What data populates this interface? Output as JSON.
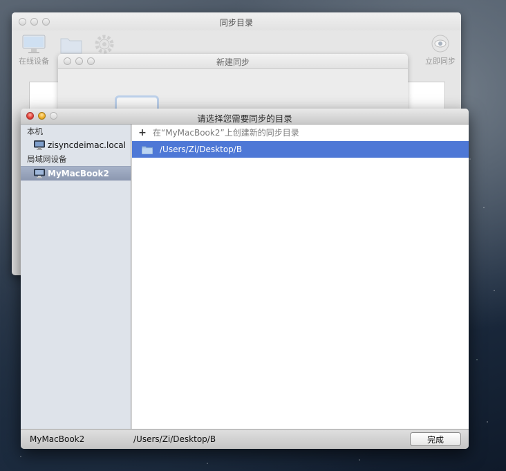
{
  "background_window": {
    "title": "同步目录",
    "toolbar": {
      "online_devices_label": "在线设备",
      "sync_now_label": "立即同步"
    }
  },
  "middle_sheet": {
    "title": "新建同步"
  },
  "dialog": {
    "title": "请选择您需要同步的目录",
    "sidebar": {
      "local_group_label": "本机",
      "local_items": [
        {
          "label": "zisyncdeimac.local",
          "icon": "imac-icon"
        }
      ],
      "lan_group_label": "局域网设备",
      "lan_items": [
        {
          "label": "MyMacBook2",
          "icon": "imac-icon",
          "selected": true
        }
      ]
    },
    "list": {
      "add_label": "在“MyMacBook2”上创建新的同步目录",
      "items": [
        {
          "path": "/Users/Zi/Desktop/B",
          "icon": "folder-icon",
          "selected": true
        }
      ]
    },
    "statusbar": {
      "device": "MyMacBook2",
      "path": "/Users/Zi/Desktop/B",
      "done_label": "完成"
    }
  },
  "colors": {
    "selection": "#4e78d6",
    "sidebar_bg": "#dee3ea",
    "sidebar_selected": "#8b97b0",
    "close": "#e2443a",
    "minimize": "#f1b12b"
  }
}
